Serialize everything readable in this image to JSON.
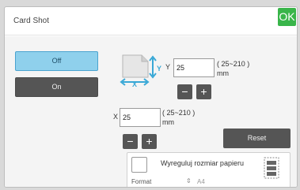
{
  "dialog": {
    "title": "Card Shot",
    "ok_label": "OK"
  },
  "mode": {
    "off_label": "Off",
    "on_label": "On",
    "selected": "Off"
  },
  "diagram": {
    "y_axis_label": "Y",
    "x_axis_label": "X"
  },
  "y_size": {
    "label": "Y",
    "value": "25",
    "range": "( 25~210 )",
    "unit": "mm"
  },
  "x_size": {
    "label": "X",
    "value": "25",
    "range": "( 25~210 )",
    "unit": "mm"
  },
  "stepper": {
    "minus": "−",
    "plus": "+"
  },
  "reset_label": "Reset",
  "paper": {
    "fit_label": "Wyreguluj rozmiar papieru",
    "fit_checked": false,
    "format_label": "Format",
    "format_arrows": "⇕",
    "format_value": "A4"
  },
  "colors": {
    "ok_green": "#39b54a",
    "selected_blue": "#8fd0ec",
    "dark_button": "#555555",
    "diagram_cyan": "#39a8d6"
  }
}
